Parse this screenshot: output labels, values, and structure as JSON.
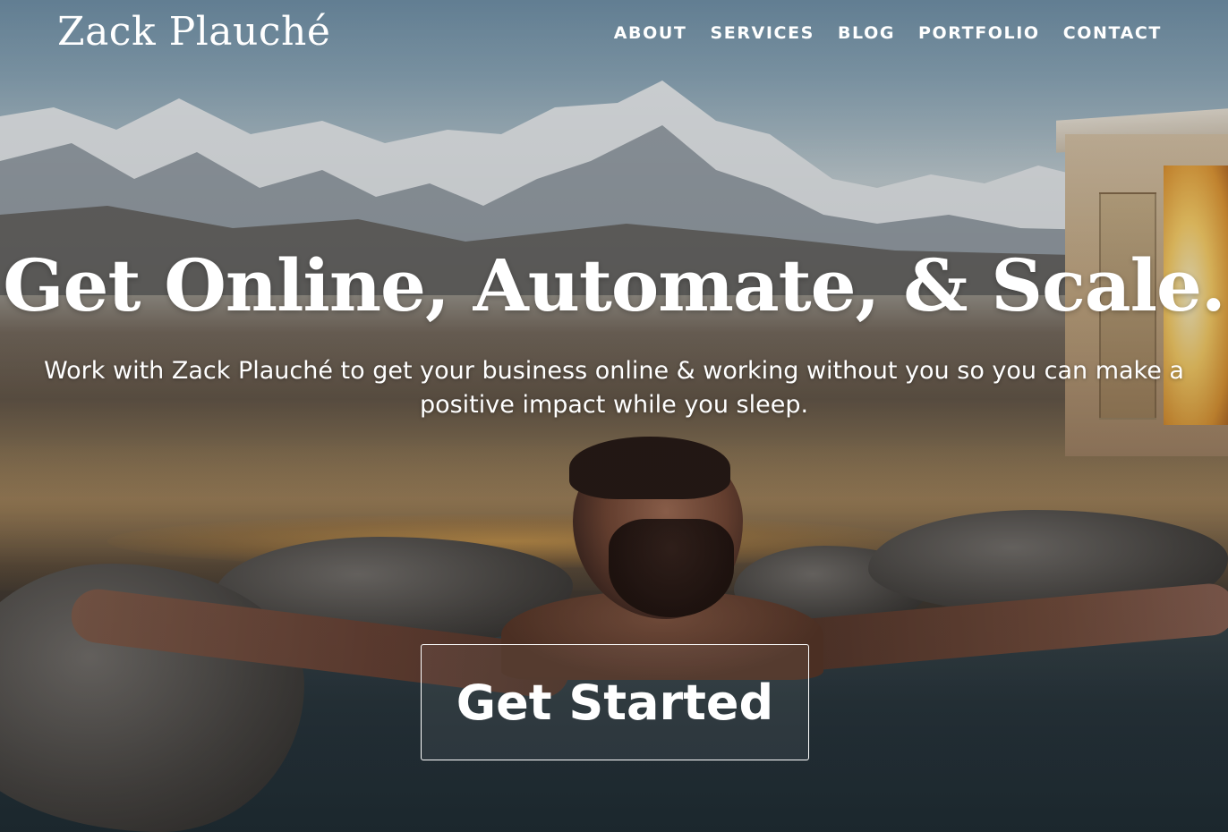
{
  "header": {
    "logo": "Zack Plauché",
    "nav": [
      {
        "label": "ABOUT"
      },
      {
        "label": "SERVICES"
      },
      {
        "label": "BLOG"
      },
      {
        "label": "PORTFOLIO"
      },
      {
        "label": "CONTACT"
      }
    ]
  },
  "hero": {
    "headline": "Get Online, Automate, & Scale.",
    "subtext": "Work with Zack Plauché to get your business online & working without you so you can make a positive impact while you sleep.",
    "cta_label": "Get Started"
  },
  "colors": {
    "text": "#ffffff",
    "sky": "#8aa6b8",
    "water": "#2c3a42"
  }
}
